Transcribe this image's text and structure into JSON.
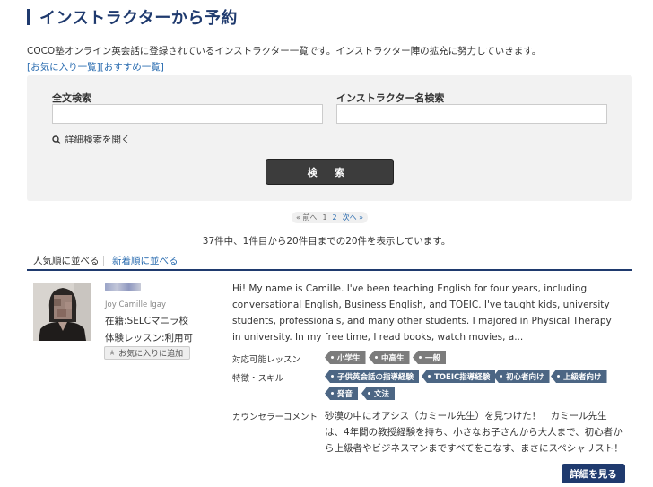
{
  "header": {
    "title": "インストラクターから予約"
  },
  "intro": "COCO塾オンライン英会話に登録されているインストラクター一覧です。インストラクター陣の拡充に努力していきます。",
  "links": {
    "favorites": "[お気に入り一覧]",
    "recommended": "[おすすめ一覧]"
  },
  "search": {
    "fulltext_label": "全文検索",
    "fulltext_value": "",
    "name_label": "インストラクター名検索",
    "name_value": "",
    "advanced_toggle": "詳細検索を開く",
    "submit_label": "検 索"
  },
  "pager": {
    "prev": "« 前へ",
    "pages": [
      "1",
      "2"
    ],
    "next": "次へ »"
  },
  "results": {
    "count_text": "37件中、1件目から20件目までの20件を表示しています。"
  },
  "sort": {
    "popular": "人気順に並べる",
    "newest": "新着順に並べる"
  },
  "instructor": {
    "name_romanized": "Joy Camille Igay",
    "location": "在籍:SELCマニラ校",
    "trial": "体験レッスン:利用可",
    "favorite_button": "お気に入りに追加",
    "bio": "Hi! My name is Camille. I've been teaching English for four years, including conversational English, Business English, and TOEIC. I've taught kids, university students, professionals, and many other students. I majored in Physical Therapy in university. In my free time, I read books, watch movies, a...",
    "lessons_label": "対応可能レッスン",
    "lessons": [
      "小学生",
      "中高生",
      "一般"
    ],
    "skills_label": "特徴・スキル",
    "skills": [
      "子供英会話の指導経験",
      "TOEIC指導経験",
      "初心者向け",
      "上級者向け",
      "発音",
      "文法"
    ],
    "comment_label": "カウンセラーコメント",
    "comment": "砂漠の中にオアシス（カミール先生）を見つけた！　カミール先生は、4年間の教授経験を持ち、小さなお子さんから大人まで、初心者から上級者やビジネスマンまですべてをこなす、まさにスペシャリスト！なかなか長続きしない、先生と",
    "detail_button": "詳細を見る"
  },
  "colors": {
    "navy": "#1f3a6e",
    "link": "#2a6cb0",
    "tag": "#4c6684",
    "tag_gray": "#7c7c7c"
  }
}
